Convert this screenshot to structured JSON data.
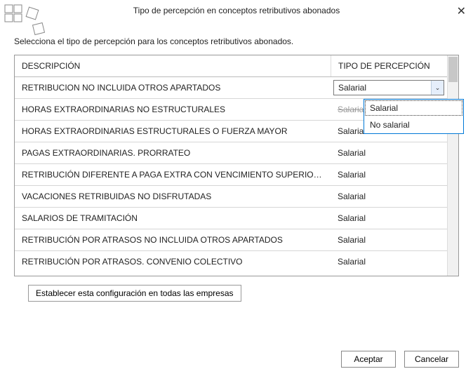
{
  "header": {
    "title": "Tipo de percepción en conceptos retributivos abonados",
    "subtitle": "Selecciona el tipo de percepción para los conceptos retributivos abonados."
  },
  "table": {
    "columns": {
      "description": "DESCRIPCIÓN",
      "type": "TIPO DE PERCEPCIÓN"
    },
    "rows": [
      {
        "desc": "RETRIBUCION NO INCLUIDA OTROS APARTADOS",
        "type": "Salarial",
        "editing": true
      },
      {
        "desc": "HORAS EXTRAORDINARIAS NO ESTRUCTURALES",
        "type": "Salarial",
        "obscured": true
      },
      {
        "desc": "HORAS EXTRAORDINARIAS ESTRUCTURALES O FUERZA MAYOR",
        "type": "Salarial"
      },
      {
        "desc": "PAGAS EXTRAORDINARIAS. PRORRATEO",
        "type": "Salarial"
      },
      {
        "desc": "RETRIBUCIÓN DIFERENTE A PAGA EXTRA CON VENCIMIENTO SUPERIOR AL MES D...",
        "type": "Salarial"
      },
      {
        "desc": "VACACIONES RETRIBUIDAS NO DISFRUTADAS",
        "type": "Salarial"
      },
      {
        "desc": "SALARIOS DE TRAMITACIÓN",
        "type": "Salarial"
      },
      {
        "desc": "RETRIBUCIÓN POR ATRASOS NO INCLUIDA OTROS APARTADOS",
        "type": "Salarial"
      },
      {
        "desc": "RETRIBUCIÓN POR ATRASOS. CONVENIO COLECTIVO",
        "type": "Salarial"
      }
    ]
  },
  "dropdown": {
    "options": [
      "Salarial",
      "No salarial"
    ],
    "selected": "Salarial"
  },
  "buttons": {
    "config_all": "Establecer esta configuración en todas las empresas",
    "accept": "Aceptar",
    "cancel": "Cancelar"
  }
}
